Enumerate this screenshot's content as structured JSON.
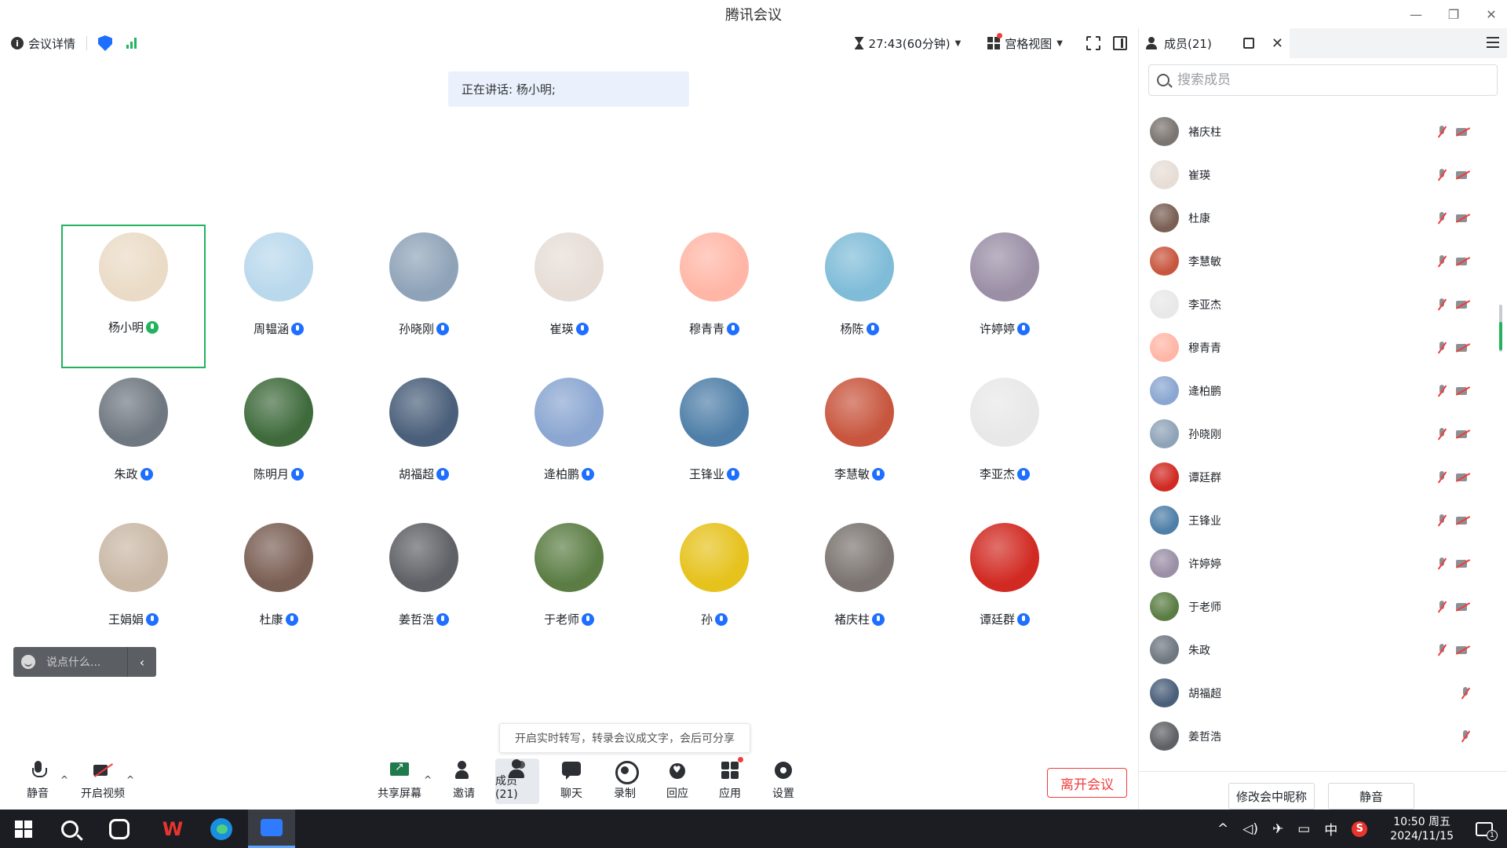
{
  "window": {
    "title": "腾讯会议"
  },
  "topbar": {
    "meeting_info": "会议详情",
    "timer": "27:43(60分钟)",
    "view_mode": "宫格视图"
  },
  "speaking": "正在讲话: 杨小明;",
  "grid": {
    "tiles": [
      {
        "name": "杨小明",
        "active": true,
        "color": "#eadbc6"
      },
      {
        "name": "周韫涵",
        "color": "#b9d8ec"
      },
      {
        "name": "孙晓刚",
        "color": "#8fa3b8"
      },
      {
        "name": "崔瑛",
        "color": "#e6ddd6"
      },
      {
        "name": "穆青青",
        "color": "#ffb6a6"
      },
      {
        "name": "杨陈",
        "color": "#7fbcd8"
      },
      {
        "name": "许婷婷",
        "color": "#9b8fa6"
      },
      {
        "name": "朱政",
        "color": "#6f7780"
      },
      {
        "name": "陈明月",
        "color": "#3f6b3c"
      },
      {
        "name": "胡福超",
        "color": "#4a5f7a"
      },
      {
        "name": "逄柏鹏",
        "color": "#8aa6d1"
      },
      {
        "name": "王锋业",
        "color": "#4f7fa8"
      },
      {
        "name": "李慧敏",
        "color": "#c8563e"
      },
      {
        "name": "李亚杰",
        "color": "#e8e8e8"
      },
      {
        "name": "王娟娟",
        "color": "#c9b8a6"
      },
      {
        "name": "杜康",
        "color": "#7a5f54"
      },
      {
        "name": "姜哲浩",
        "color": "#5f6166"
      },
      {
        "name": "于老师",
        "color": "#5b7d44"
      },
      {
        "name": "孙",
        "color": "#e6c21c"
      },
      {
        "name": "褚庆柱",
        "color": "#7b7470"
      },
      {
        "name": "谭廷群",
        "color": "#d12a22"
      }
    ]
  },
  "chat": {
    "placeholder": "说点什么..."
  },
  "tooltip": "开启实时转写，转录会议成文字，会后可分享",
  "toolbar": {
    "mute": "静音",
    "video": "开启视频",
    "share": "共享屏幕",
    "invite": "邀请",
    "members": "成员(21)",
    "chat": "聊天",
    "record": "录制",
    "react": "回应",
    "apps": "应用",
    "settings": "设置",
    "leave": "离开会议"
  },
  "panel": {
    "tab": "成员(21)",
    "search_placeholder": "搜索成员",
    "members": [
      {
        "name": "褚庆柱",
        "color": "#7b7470",
        "cam": true
      },
      {
        "name": "崔瑛",
        "color": "#e6ddd6",
        "cam": true
      },
      {
        "name": "杜康",
        "color": "#7a5f54",
        "cam": true
      },
      {
        "name": "李慧敏",
        "color": "#c8563e",
        "cam": true
      },
      {
        "name": "李亚杰",
        "color": "#e8e8e8",
        "cam": true
      },
      {
        "name": "穆青青",
        "color": "#ffb6a6",
        "cam": true
      },
      {
        "name": "逄柏鹏",
        "color": "#8aa6d1",
        "cam": true
      },
      {
        "name": "孙晓刚",
        "color": "#8fa3b8",
        "cam": true
      },
      {
        "name": "谭廷群",
        "color": "#d12a22",
        "cam": true
      },
      {
        "name": "王锋业",
        "color": "#4f7fa8",
        "cam": true
      },
      {
        "name": "许婷婷",
        "color": "#9b8fa6",
        "cam": true
      },
      {
        "name": "于老师",
        "color": "#5b7d44",
        "cam": true
      },
      {
        "name": "朱政",
        "color": "#6f7780",
        "cam": true
      },
      {
        "name": "胡福超",
        "color": "#4a5f7a",
        "cam": false
      },
      {
        "name": "姜哲浩",
        "color": "#5f6166",
        "cam": false
      }
    ],
    "rename_button": "修改会中昵称",
    "mute_button": "静音"
  },
  "taskbar": {
    "ime": "中",
    "time": "10:50 周五",
    "date": "2024/11/15",
    "notifications": "1"
  }
}
